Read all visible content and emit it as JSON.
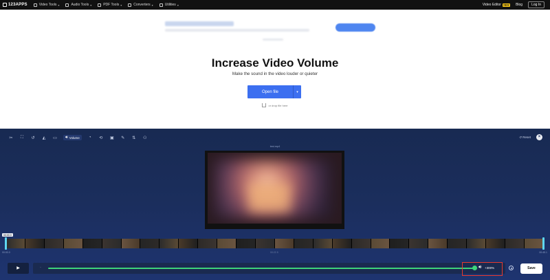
{
  "nav": {
    "logo": "123APPS",
    "items": [
      {
        "label": "Video Tools",
        "icon": "video-icon"
      },
      {
        "label": "Audio Tools",
        "icon": "audio-icon"
      },
      {
        "label": "PDF Tools",
        "icon": "pdf-icon"
      },
      {
        "label": "Converters",
        "icon": "converter-icon"
      },
      {
        "label": "Utilities",
        "icon": "utilities-icon"
      }
    ],
    "video_editor": "Video Editor",
    "new_badge": "NEW",
    "blog": "Blog",
    "login": "Log In"
  },
  "hero": {
    "title": "Increase Video Volume",
    "subtitle": "Make the sound in the video louder or quieter",
    "open_file": "Open file",
    "drop_hint": "or drop file here"
  },
  "editor": {
    "volume_tool": "Volume",
    "reset": "Reset",
    "file_name": "test.mp4",
    "time_chip": "00:00.0",
    "time_start": "00:00.0",
    "time_mid": "00:22.5",
    "time_end": "00:45.1",
    "volume_value": "+300%",
    "save": "Save"
  },
  "colors": {
    "accent": "#3c6ff0",
    "slider": "#3dd47a",
    "highlight": "#e83a2e",
    "editor_bg": "#1b2e5d"
  }
}
